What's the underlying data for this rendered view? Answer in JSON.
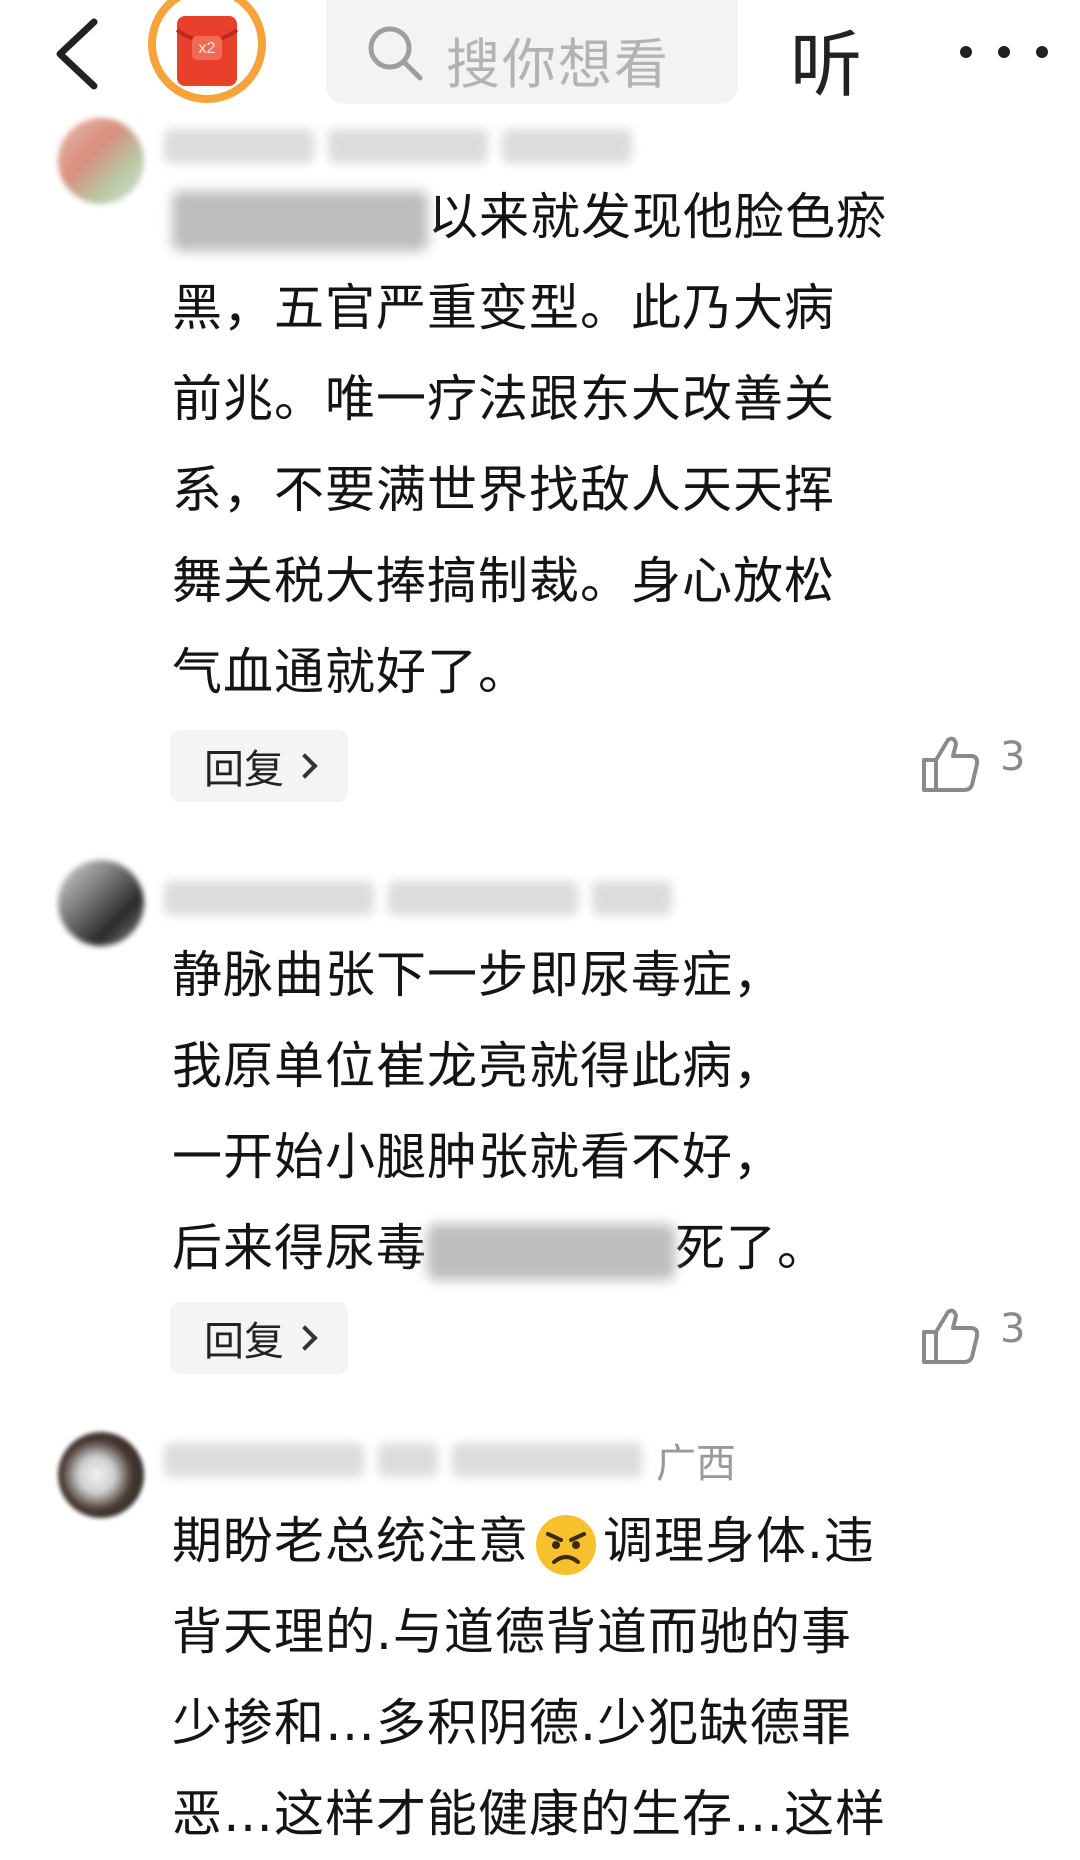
{
  "header": {
    "red_packet_badge": "x2",
    "search_placeholder": "搜你想看",
    "listen_label": "听"
  },
  "comments": [
    {
      "meta_region": "",
      "lines": [
        "以来就发现他脸色瘀",
        "黑，五官严重变型。此乃大病",
        "前兆。唯一疗法跟东大改善关",
        "系，不要满世界找敌人天天挥",
        "舞关税大捧搞制裁。身心放松",
        "气血通就好了。"
      ],
      "reply_label": "回复",
      "like_count": "3"
    },
    {
      "meta_region": "",
      "lines": [
        "静脉曲张下一步即尿毒症，",
        "我原单位崔龙亮就得此病，",
        "一开始小腿肿张就看不好，",
        "后来得尿毒",
        "死了。"
      ],
      "reply_label": "回复",
      "like_count": "3"
    },
    {
      "meta_region": "广西",
      "lines": [
        "期盼老总统注意",
        "调理身体.违",
        "背天理的.与道德背道而驰的事",
        "少掺和…多积阴德.少犯缺德罪",
        "恶…这样才能健康的生存…这样"
      ]
    }
  ],
  "colors": {
    "accent_red": "#e8402c",
    "accent_orange": "#f5a33a",
    "text": "#141414",
    "muted": "#9a9a9a",
    "reply_bg": "#f4f4f4"
  },
  "icons": [
    "back-arrow-icon",
    "red-packet-icon",
    "search-icon",
    "more-icon",
    "thumbs-up-icon",
    "angry-emoji-icon"
  ]
}
